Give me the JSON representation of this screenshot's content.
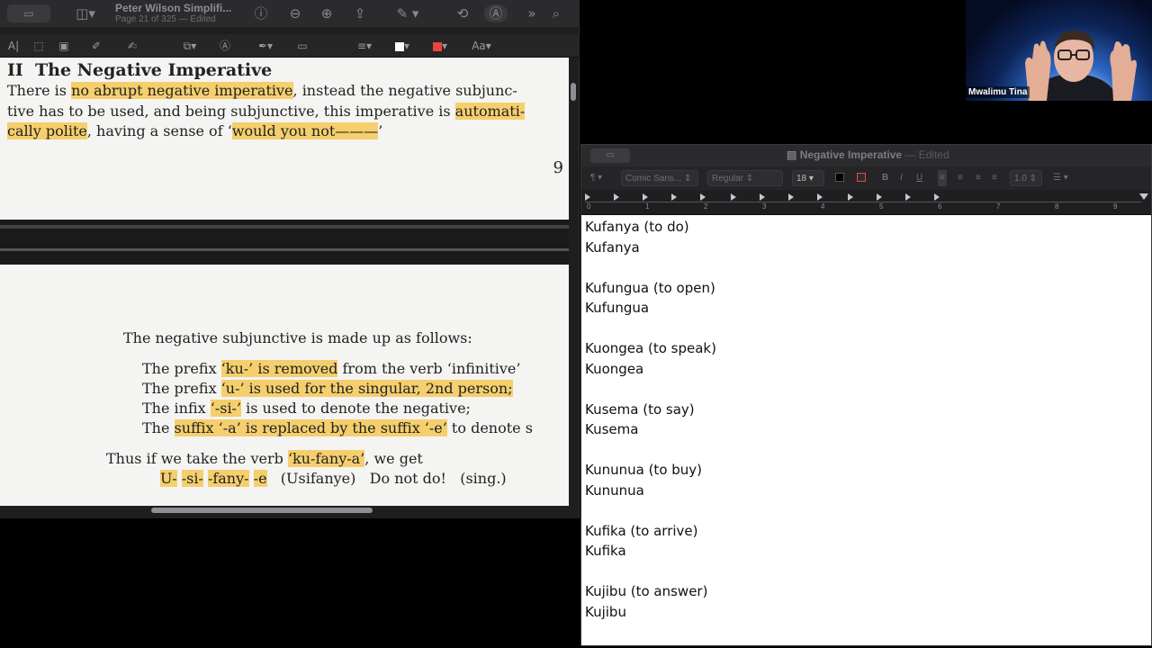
{
  "preview": {
    "title": "Peter Wilson Simplifi...",
    "subtitle": "Page 21 of 325 — Edited",
    "markup_text_style": "Aa",
    "page": {
      "heading_num": "II",
      "heading": "The Negative Imperative",
      "line1": {
        "pre": "There is ",
        "hl1": "no abrupt negative imperative",
        "post": ", instead the negative subjunc-"
      },
      "line2": {
        "pre": "tive has to be used, and being subjunctive, this imperative is ",
        "hl1": "automati-"
      },
      "line3": {
        "hl1": "cally polite",
        "mid": ", having a sense of ‘",
        "hl2": "would you not———",
        "post": "’"
      },
      "page_number": "9",
      "intro": "The negative subjunctive is made up as follows:",
      "rule1": {
        "pre": "The prefix ",
        "hl": "‘ku-’ is removed",
        "post": " from the verb ‘infinitive’"
      },
      "rule2": {
        "pre": "The prefix ",
        "hl": "‘u-’ is used for the singular, 2nd person;"
      },
      "rule3": {
        "pre": "The infix ",
        "hl": "‘-si-’",
        "post": " is used to denote the negative;"
      },
      "rule4": {
        "pre": "The ",
        "hl": "suffix ‘-a’ is replaced by the suffix ‘-e’",
        "post": " to denote s"
      },
      "thus": {
        "pre": "Thus if we take the verb ",
        "hl": "‘ku-fany-a’",
        "post": ", we get"
      },
      "example": {
        "u": "U-",
        "si": "-si-",
        "fany": "-fany-",
        "e": "-e",
        "word": "(Usifanye)",
        "gloss": "Do not do!",
        "note": "(sing.)"
      }
    }
  },
  "webcam": {
    "name": "Mwalimu Tina"
  },
  "textedit": {
    "title": "Negative Imperative",
    "edited": "— Edited",
    "font_family": "Comic Sans...",
    "font_style": "Regular",
    "font_size": "18",
    "line_spacing": "1.0",
    "ruler": [
      "0",
      "1",
      "2",
      "3",
      "4",
      "5",
      "6",
      "7",
      "8",
      "9"
    ],
    "lines": [
      "Kufanya (to do)",
      "Kufanya",
      "",
      "Kufungua (to open)",
      "Kufungua",
      "",
      "Kuongea (to speak)",
      "Kuongea",
      "",
      "Kusema (to say)",
      "Kusema",
      "",
      "Kununua (to buy)",
      "Kununua",
      "",
      "Kufika (to arrive)",
      "Kufika",
      "",
      "Kujibu (to answer)",
      "Kujibu"
    ]
  },
  "colors": {
    "highlight": "#f5cf6d",
    "accent_red": "#e8473c"
  }
}
